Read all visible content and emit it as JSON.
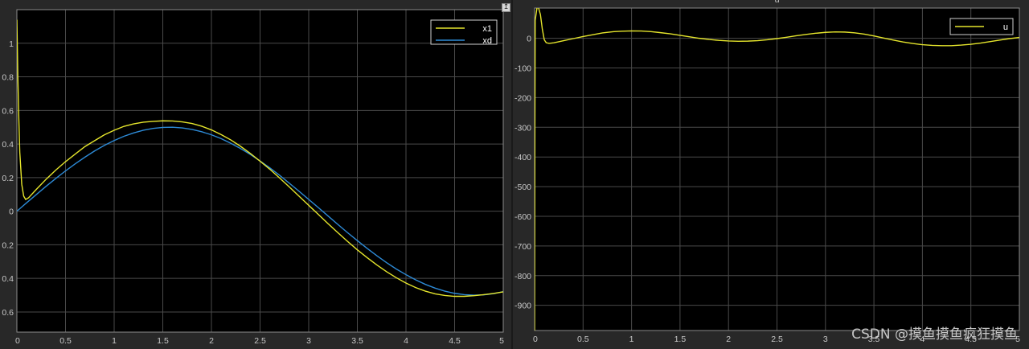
{
  "undock_icon": "arrow-up-icon",
  "colors": {
    "background": "#282828",
    "axes_bg": "#000000",
    "grid": "#4a4a4a",
    "x1": "#e5e52c",
    "xd": "#2d8ad6",
    "u": "#e5e52c"
  },
  "watermark": "CSDN @摸鱼摸鱼疯狂摸鱼",
  "chart_data": [
    {
      "type": "line",
      "title": "",
      "xlim": [
        0,
        5
      ],
      "ylim": [
        -0.72,
        1.2
      ],
      "grid": true,
      "legend_position": "top-right",
      "x_ticks": [
        "0",
        "0.5",
        "1",
        "1.5",
        "2",
        "2.5",
        "3",
        "3.5",
        "4",
        "4.5",
        "5"
      ],
      "y_ticks": [
        {
          "value": 1,
          "label": "1"
        },
        {
          "value": 0.8,
          "label": "0.8"
        },
        {
          "value": 0.6,
          "label": "0.6"
        },
        {
          "value": 0.4,
          "label": "0.4"
        },
        {
          "value": 0.2,
          "label": "0.2"
        },
        {
          "value": 0,
          "label": "0"
        },
        {
          "value": -0.2,
          "label": "0.2"
        },
        {
          "value": -0.4,
          "label": "0.4"
        },
        {
          "value": -0.6,
          "label": "0.6"
        }
      ],
      "series": [
        {
          "name": "x1",
          "color": "#e5e52c",
          "points": [
            [
              0,
              1.14
            ],
            [
              0.01,
              0.8
            ],
            [
              0.02,
              0.55
            ],
            [
              0.03,
              0.35
            ],
            [
              0.05,
              0.16
            ],
            [
              0.07,
              0.09
            ],
            [
              0.09,
              0.07
            ],
            [
              0.12,
              0.08
            ],
            [
              0.2,
              0.13
            ],
            [
              0.3,
              0.19
            ],
            [
              0.4,
              0.245
            ],
            [
              0.5,
              0.295
            ],
            [
              0.6,
              0.34
            ],
            [
              0.7,
              0.385
            ],
            [
              0.8,
              0.42
            ],
            [
              0.9,
              0.455
            ],
            [
              1.0,
              0.482
            ],
            [
              1.1,
              0.505
            ],
            [
              1.2,
              0.52
            ],
            [
              1.3,
              0.53
            ],
            [
              1.4,
              0.535
            ],
            [
              1.5,
              0.538
            ],
            [
              1.6,
              0.537
            ],
            [
              1.7,
              0.532
            ],
            [
              1.8,
              0.522
            ],
            [
              1.9,
              0.506
            ],
            [
              2.0,
              0.484
            ],
            [
              2.1,
              0.456
            ],
            [
              2.2,
              0.424
            ],
            [
              2.3,
              0.386
            ],
            [
              2.4,
              0.344
            ],
            [
              2.5,
              0.298
            ],
            [
              2.6,
              0.25
            ],
            [
              2.7,
              0.198
            ],
            [
              2.8,
              0.145
            ],
            [
              2.9,
              0.09
            ],
            [
              3.0,
              0.035
            ],
            [
              3.1,
              -0.02
            ],
            [
              3.2,
              -0.075
            ],
            [
              3.3,
              -0.128
            ],
            [
              3.4,
              -0.18
            ],
            [
              3.5,
              -0.23
            ],
            [
              3.6,
              -0.276
            ],
            [
              3.7,
              -0.32
            ],
            [
              3.8,
              -0.36
            ],
            [
              3.9,
              -0.396
            ],
            [
              4.0,
              -0.428
            ],
            [
              4.1,
              -0.455
            ],
            [
              4.2,
              -0.476
            ],
            [
              4.3,
              -0.492
            ],
            [
              4.4,
              -0.502
            ],
            [
              4.5,
              -0.507
            ],
            [
              4.6,
              -0.507
            ],
            [
              4.7,
              -0.503
            ],
            [
              4.8,
              -0.497
            ],
            [
              4.9,
              -0.49
            ],
            [
              5.0,
              -0.48
            ]
          ]
        },
        {
          "name": "xd",
          "color": "#2d8ad6",
          "points": [
            [
              0,
              0
            ],
            [
              0.1,
              0.05
            ],
            [
              0.2,
              0.099
            ],
            [
              0.3,
              0.148
            ],
            [
              0.4,
              0.195
            ],
            [
              0.5,
              0.24
            ],
            [
              0.6,
              0.282
            ],
            [
              0.7,
              0.322
            ],
            [
              0.8,
              0.359
            ],
            [
              0.9,
              0.392
            ],
            [
              1.0,
              0.421
            ],
            [
              1.1,
              0.446
            ],
            [
              1.2,
              0.466
            ],
            [
              1.3,
              0.482
            ],
            [
              1.4,
              0.493
            ],
            [
              1.5,
              0.499
            ],
            [
              1.6,
              0.5
            ],
            [
              1.7,
              0.496
            ],
            [
              1.8,
              0.487
            ],
            [
              1.9,
              0.473
            ],
            [
              2.0,
              0.455
            ],
            [
              2.1,
              0.432
            ],
            [
              2.2,
              0.404
            ],
            [
              2.3,
              0.373
            ],
            [
              2.4,
              0.338
            ],
            [
              2.5,
              0.299
            ],
            [
              2.6,
              0.258
            ],
            [
              2.7,
              0.214
            ],
            [
              2.8,
              0.167
            ],
            [
              2.9,
              0.119
            ],
            [
              3.0,
              0.07
            ],
            [
              3.1,
              0.021
            ],
            [
              3.2,
              -0.029
            ],
            [
              3.3,
              -0.079
            ],
            [
              3.4,
              -0.128
            ],
            [
              3.5,
              -0.175
            ],
            [
              3.6,
              -0.221
            ],
            [
              3.7,
              -0.265
            ],
            [
              3.8,
              -0.306
            ],
            [
              3.9,
              -0.344
            ],
            [
              4.0,
              -0.378
            ],
            [
              4.1,
              -0.409
            ],
            [
              4.2,
              -0.436
            ],
            [
              4.3,
              -0.458
            ],
            [
              4.4,
              -0.476
            ],
            [
              4.5,
              -0.489
            ],
            [
              4.6,
              -0.497
            ],
            [
              4.7,
              -0.5
            ],
            [
              4.8,
              -0.498
            ],
            [
              4.9,
              -0.491
            ],
            [
              5.0,
              -0.479
            ]
          ]
        }
      ]
    },
    {
      "type": "line",
      "title": "u",
      "xlim": [
        0,
        5
      ],
      "ylim": [
        -985,
        102
      ],
      "grid": true,
      "legend_position": "top-right",
      "x_ticks": [
        "0",
        "0.5",
        "1",
        "1.5",
        "2",
        "2.5",
        "3",
        "3.5",
        "4",
        "4.5",
        "5"
      ],
      "y_ticks": [
        {
          "value": 0,
          "label": "0"
        },
        {
          "value": -100,
          "label": "-100"
        },
        {
          "value": -200,
          "label": "-200"
        },
        {
          "value": -300,
          "label": "-300"
        },
        {
          "value": -400,
          "label": "-400"
        },
        {
          "value": -500,
          "label": "-500"
        },
        {
          "value": -600,
          "label": "-600"
        },
        {
          "value": -700,
          "label": "-700"
        },
        {
          "value": -800,
          "label": "-800"
        },
        {
          "value": -900,
          "label": "-900"
        }
      ],
      "series": [
        {
          "name": "u",
          "color": "#e5e52c",
          "points": [
            [
              0,
              -985
            ],
            [
              0.003,
              -300
            ],
            [
              0.006,
              60
            ],
            [
              0.03,
              115
            ],
            [
              0.06,
              80
            ],
            [
              0.08,
              30
            ],
            [
              0.1,
              -5
            ],
            [
              0.12,
              -15
            ],
            [
              0.15,
              -17
            ],
            [
              0.2,
              -15
            ],
            [
              0.3,
              -8
            ],
            [
              0.4,
              -1
            ],
            [
              0.5,
              6
            ],
            [
              0.6,
              12
            ],
            [
              0.7,
              18
            ],
            [
              0.8,
              22
            ],
            [
              0.9,
              24
            ],
            [
              1.0,
              25
            ],
            [
              1.1,
              24.5
            ],
            [
              1.2,
              22.5
            ],
            [
              1.3,
              19
            ],
            [
              1.4,
              15
            ],
            [
              1.5,
              10
            ],
            [
              1.6,
              5
            ],
            [
              1.7,
              0
            ],
            [
              1.8,
              -4
            ],
            [
              1.9,
              -7
            ],
            [
              2.0,
              -9
            ],
            [
              2.1,
              -10
            ],
            [
              2.2,
              -9.5
            ],
            [
              2.3,
              -8
            ],
            [
              2.4,
              -5
            ],
            [
              2.5,
              -1
            ],
            [
              2.6,
              3.5
            ],
            [
              2.7,
              8.5
            ],
            [
              2.8,
              13
            ],
            [
              2.9,
              17
            ],
            [
              3.0,
              20
            ],
            [
              3.1,
              21.5
            ],
            [
              3.2,
              21
            ],
            [
              3.3,
              18.5
            ],
            [
              3.4,
              14
            ],
            [
              3.5,
              8
            ],
            [
              3.6,
              1
            ],
            [
              3.7,
              -6
            ],
            [
              3.8,
              -12.5
            ],
            [
              3.9,
              -17.5
            ],
            [
              4.0,
              -21.5
            ],
            [
              4.1,
              -24
            ],
            [
              4.2,
              -25
            ],
            [
              4.3,
              -25
            ],
            [
              4.4,
              -23
            ],
            [
              4.5,
              -20
            ],
            [
              4.6,
              -16
            ],
            [
              4.7,
              -11
            ],
            [
              4.8,
              -6
            ],
            [
              4.9,
              -1
            ],
            [
              5.0,
              3
            ]
          ]
        }
      ]
    }
  ]
}
